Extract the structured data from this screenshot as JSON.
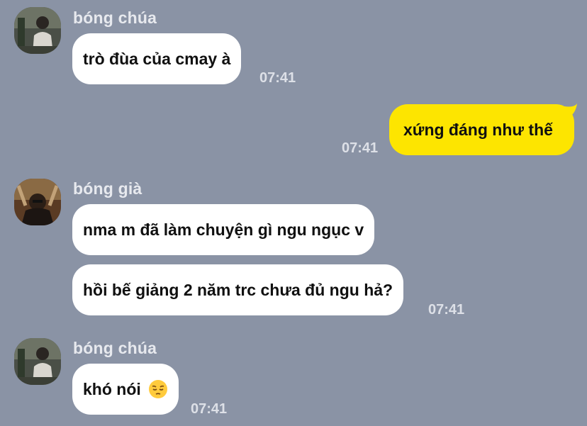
{
  "colors": {
    "background": "#8a93a5",
    "incoming_bubble": "#ffffff",
    "outgoing_bubble": "#fde500",
    "meta_text": "#dde0e7"
  },
  "messages": [
    {
      "type": "incoming",
      "sender": "bóng chúa",
      "avatar_icon": "avatar-photo-icon",
      "text": "trò đùa của cmay à",
      "time": "07:41"
    },
    {
      "type": "outgoing",
      "text": "xứng đáng như thế",
      "time": "07:41"
    },
    {
      "type": "incoming",
      "sender": "bóng già",
      "avatar_icon": "avatar-photo-icon",
      "text": "nma m đã làm chuyện gì ngu ngục v",
      "text2": "hồi bế giảng 2 năm trc chưa đủ ngu hả?",
      "time": "07:41"
    },
    {
      "type": "incoming",
      "sender": "bóng chúa",
      "avatar_icon": "avatar-photo-icon",
      "text": "khó nói",
      "emoji": "pensive-face-icon",
      "time": "07:41"
    }
  ]
}
